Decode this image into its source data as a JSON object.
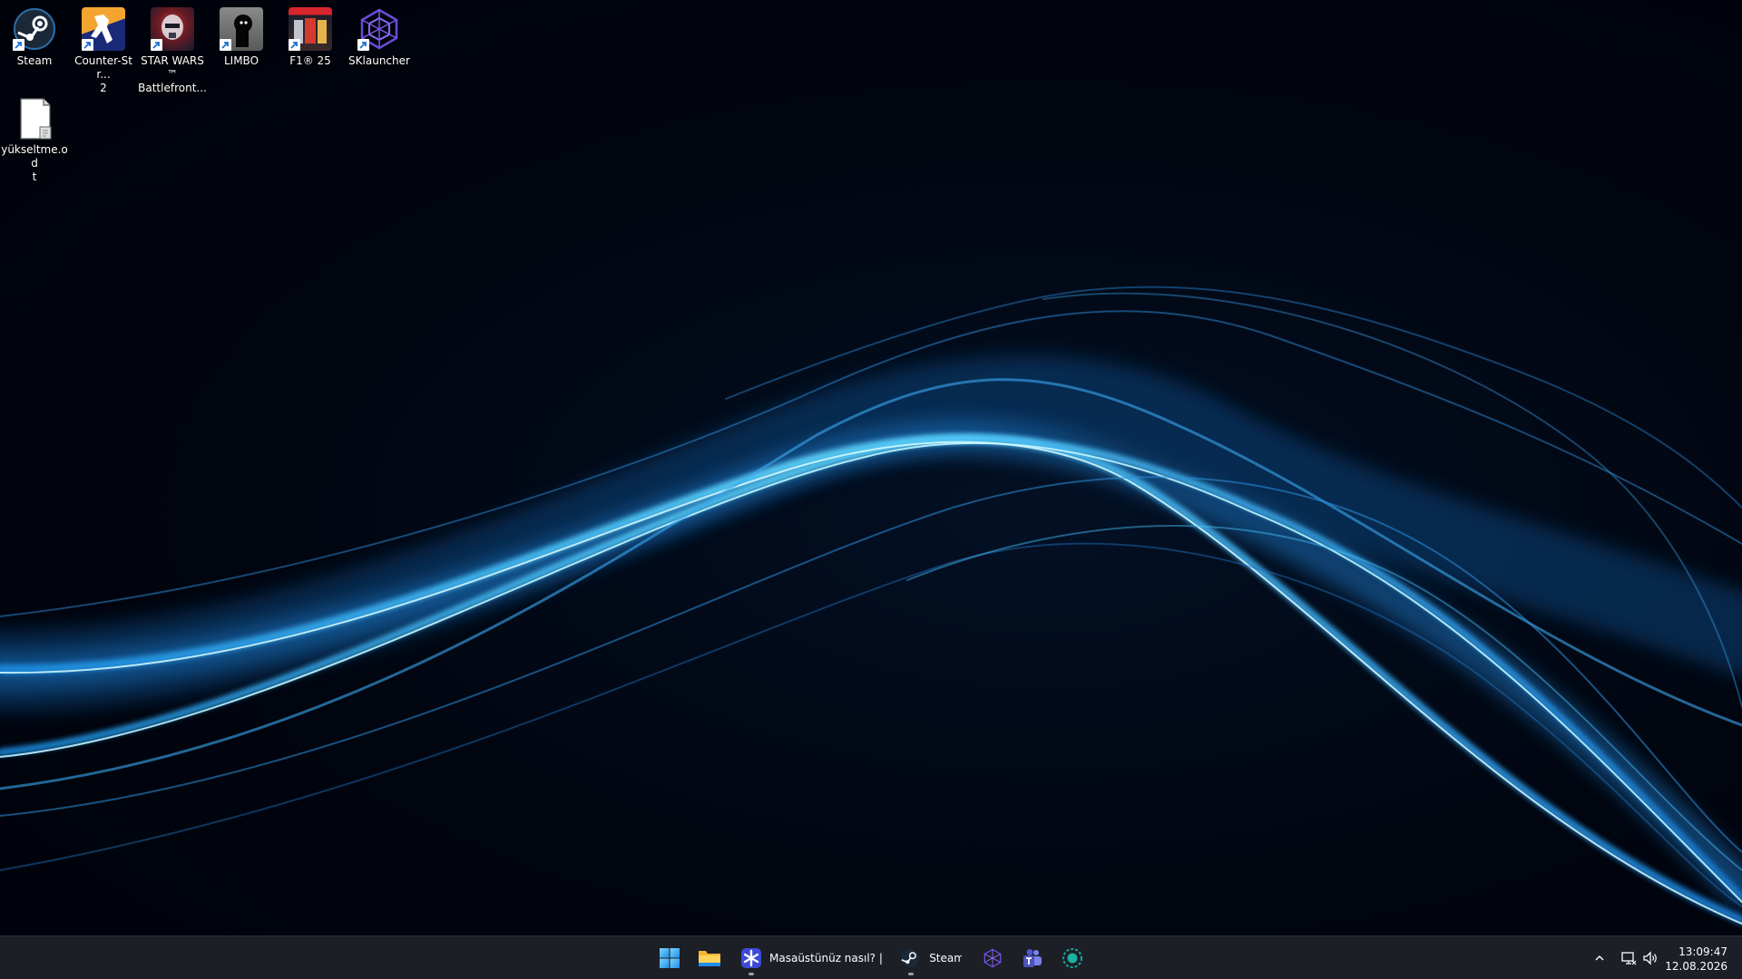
{
  "desktop": {
    "icons": [
      {
        "label": "Steam",
        "icon": "steam-icon"
      },
      {
        "label": "Counter-Str...\n2",
        "icon": "counter-strike-icon"
      },
      {
        "label": "STAR WARS™\nBattlefront...",
        "icon": "star-wars-battlefront-icon"
      },
      {
        "label": "LIMBO",
        "icon": "limbo-icon"
      },
      {
        "label": "F1® 25",
        "icon": "f1-25-icon"
      },
      {
        "label": "SKlauncher",
        "icon": "sklauncher-icon"
      },
      {
        "label": "yükseltme.od\nt",
        "icon": "odt-document-icon"
      }
    ]
  },
  "taskbar": {
    "start": {
      "icon": "windows-start-icon"
    },
    "explorer": {
      "icon": "file-explorer-icon"
    },
    "browser": {
      "label": "Masaüstünüz nasıl? | Tec",
      "icon": "browser-app-icon"
    },
    "steam": {
      "label": "Steam",
      "icon": "steam-icon"
    },
    "sklauncher": {
      "icon": "sklauncher-icon"
    },
    "teams": {
      "icon": "teams-icon"
    },
    "app": {
      "icon": "green-circle-app-icon"
    }
  },
  "tray": {
    "chevron": "chevron-up-icon",
    "network": "network-icon",
    "volume": "volume-icon",
    "time": "13:09:47",
    "date": "12.08.2026"
  },
  "colors": {
    "wallpaper_wave": "#3fb6ff",
    "taskbar_bg": "#1c1f26",
    "accent": "#0078d4"
  }
}
